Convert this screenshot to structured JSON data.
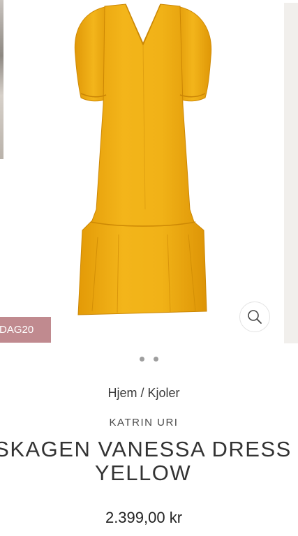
{
  "product": {
    "badge_text": "DAG20",
    "breadcrumb": "Hjem / Kjoler",
    "brand": "KATRIN URI",
    "title_line1": "SKAGEN VANESSA DRESS",
    "title_line2": "YELLOW",
    "price": "2.399,00 kr",
    "color_hex": "#f0b114"
  },
  "gallery": {
    "zoom_icon": "search-icon",
    "slide_count": 2,
    "label_icon": "brand-label"
  }
}
